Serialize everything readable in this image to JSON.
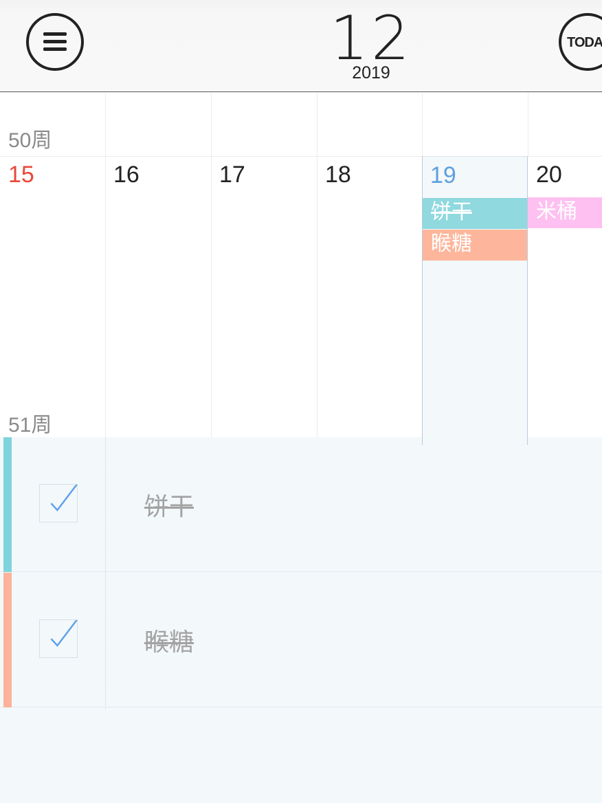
{
  "header": {
    "month": "12",
    "year": "2019",
    "today_label": "TODA"
  },
  "weeks": {
    "prev_label": "50周",
    "current_label": "51周"
  },
  "days": [
    {
      "num": "15",
      "color": "#e8483b"
    },
    {
      "num": "16",
      "color": "#222222"
    },
    {
      "num": "17",
      "color": "#222222"
    },
    {
      "num": "18",
      "color": "#222222"
    },
    {
      "num": "19",
      "color": "#5ea0dd"
    },
    {
      "num": "20",
      "color": "#222222"
    }
  ],
  "calendar_events": [
    {
      "title": "饼干",
      "day": "19",
      "color": "#8fd9df",
      "completed": true
    },
    {
      "title": "睺糖",
      "day": "19",
      "color": "#fdb69b",
      "completed": false
    },
    {
      "title": "米桶",
      "day": "20",
      "color": "#fec0f0",
      "completed": false
    }
  ],
  "tasks": [
    {
      "title": "饼干",
      "color": "#7fd4dc",
      "checked": true
    },
    {
      "title": "睺糖",
      "color": "#fdb29b",
      "checked": true
    }
  ],
  "colors": {
    "selected_day_bg": "#f3f8fb",
    "check_color": "#5ea0ea"
  },
  "icons": {
    "menu": "hamburger-menu-icon",
    "check": "checkmark-icon"
  }
}
